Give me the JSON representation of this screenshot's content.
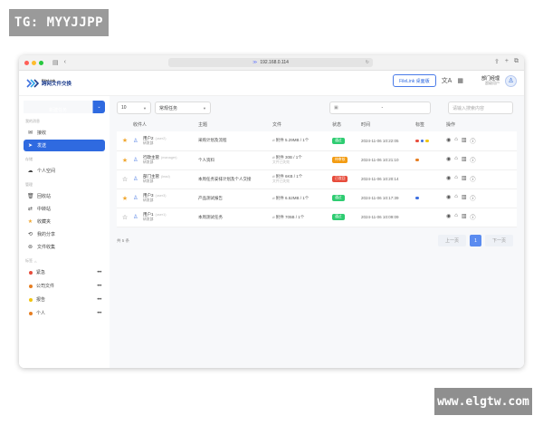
{
  "watermark_top": "TG: MYYJJPP",
  "watermark_bottom": "www.elgtw.com",
  "browser": {
    "url": "192.168.0.114"
  },
  "header": {
    "logo_en": "FileLink",
    "logo_cn": "跨网文件交换",
    "filelink_button": "FileLink 桌面版",
    "user_name": "部门经理",
    "user_role": "超级用户"
  },
  "sidebar": {
    "new_task_label": "新建任务",
    "section_messages": "我的消息",
    "nav_messages": [
      {
        "label": "接收",
        "icon": "mail-icon",
        "active": false
      },
      {
        "label": "发送",
        "icon": "send-icon",
        "active": true
      }
    ],
    "section_storage": "存储",
    "nav_storage": [
      {
        "label": "个人空间",
        "icon": "cloud-icon"
      }
    ],
    "section_manage": "管理",
    "nav_manage": [
      {
        "label": "回收站",
        "icon": "trash-icon"
      },
      {
        "label": "中转站",
        "icon": "transfer-icon"
      },
      {
        "label": "收藏夹",
        "icon": "star-icon"
      },
      {
        "label": "我的分享",
        "icon": "share-icon"
      },
      {
        "label": "文件收集",
        "icon": "collect-icon"
      }
    ],
    "section_tags": "标签",
    "tags": [
      {
        "label": "紧急",
        "color": "#e74c3c"
      },
      {
        "label": "公司文件",
        "color": "#e67e22"
      },
      {
        "label": "报告",
        "color": "#f1c40f"
      },
      {
        "label": "个人",
        "color": "#e67e22"
      }
    ]
  },
  "toolbar": {
    "page_size": "10",
    "category": "常规任务",
    "date_separator": "-",
    "search_placeholder": "请输入搜索内容"
  },
  "table": {
    "headers": [
      "收件人",
      "主题",
      "文件",
      "状态",
      "时间",
      "标签",
      "操作"
    ],
    "rows": [
      {
        "starred": true,
        "name": "用户2",
        "id": "(user2)",
        "dept": "研发部",
        "subject": "采购计划及流程",
        "file": "附件 5.29MB / 1个",
        "file_sub": "",
        "status": "通过",
        "status_color": "#2ecc71",
        "time": "2024-11-06 10:22:05",
        "tags": [
          "#e74c3c",
          "#3d6fe0",
          "#f1c40f"
        ]
      },
      {
        "starred": true,
        "name": "行政主管",
        "id": "(manager)",
        "dept": "研发部",
        "subject": "个人资料",
        "file": "附件 30B / 1个",
        "file_sub": "文件已失效",
        "status": "待审核",
        "status_color": "#f39c12",
        "time": "2024-11-06 10:21:10",
        "tags": [
          "#e67e22"
        ]
      },
      {
        "starred": false,
        "name": "部门主管",
        "id": "(lead)",
        "dept": "研发部",
        "subject": "本周任务安排计划及个人交接",
        "file": "附件 6KB / 1个",
        "file_sub": "文件已失效",
        "status": "已驳回",
        "status_color": "#e74c3c",
        "time": "2024-11-06 10:20:14",
        "tags": []
      },
      {
        "starred": true,
        "name": "用户3",
        "id": "(user3)",
        "dept": "研发部",
        "subject": "产品测试报告",
        "file": "附件 6.52MB / 1个",
        "file_sub": "",
        "status": "通过",
        "status_color": "#2ecc71",
        "time": "2024-11-06 10:17:39",
        "tags": [
          "#3d6fe0"
        ]
      },
      {
        "starred": false,
        "name": "用户1",
        "id": "(user1)",
        "dept": "研发部",
        "subject": "本周测试任务",
        "file": "附件 705B / 1个",
        "file_sub": "",
        "status": "通过",
        "status_color": "#2ecc71",
        "time": "2024-11-06 10:09:09",
        "tags": []
      }
    ]
  },
  "footer": {
    "total": "共 5 条",
    "prev": "上一页",
    "page": "1",
    "next": "下一页"
  }
}
